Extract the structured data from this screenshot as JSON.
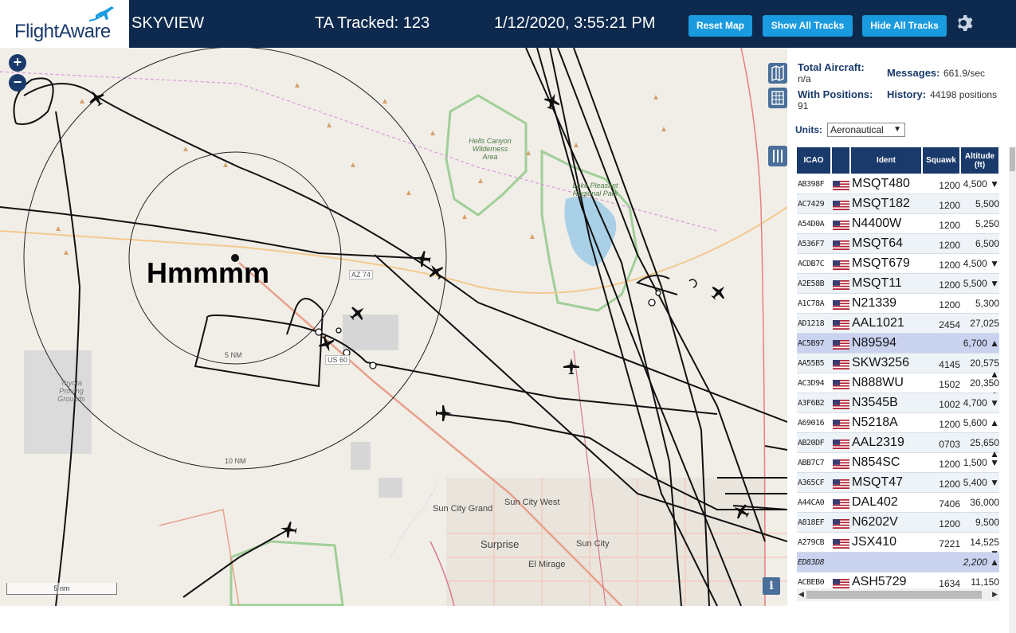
{
  "header": {
    "logo_text": "FlightAware",
    "title": "SKYVIEW",
    "tracked": "TA Tracked: 123",
    "datetime": "1/12/2020, 3:55:21 PM",
    "buttons": {
      "reset": "Reset Map",
      "show_all": "Show All Tracks",
      "hide_all": "Hide All Tracks"
    },
    "accent_color": "#1a9be0",
    "bar_color": "#0d2a4e"
  },
  "map": {
    "annotation": "Hmmmm",
    "scale_label": "5 nm",
    "zoom_in": "+",
    "zoom_out": "−",
    "info": "i",
    "range_rings": [
      "5 NM",
      "10 NM"
    ],
    "road_labels": [
      "AZ 74",
      "US 60"
    ],
    "places": {
      "hells_canyon": "Hells Canyon Wilderness Area",
      "lake_pleasant": "Lake Pleasant Regional Park",
      "toyota": "Toyota Proving Grounds",
      "sun_city_grand": "Sun City Grand",
      "sun_city_west": "Sun City West",
      "surprise": "Surprise",
      "sun_city": "Sun City",
      "el_mirage": "El Mirage"
    }
  },
  "stats": {
    "total_label": "Total Aircraft:",
    "total_value": "n/a",
    "positions_label": "With Positions:",
    "positions_value": "91",
    "messages_label": "Messages:",
    "messages_value": "661.9/sec",
    "history_label": "History:",
    "history_value": "44198 positions",
    "units_label": "Units:",
    "units_value": "Aeronautical"
  },
  "table": {
    "headers": {
      "icao": "ICAO",
      "ident": "Ident",
      "squawk": "Squawk",
      "altitude": "Altitude (ft)"
    },
    "rows": [
      {
        "icao": "AB398F",
        "ident": "MSQT480",
        "squawk": "1200",
        "alt": "4,500 ▼"
      },
      {
        "icao": "AC7429",
        "ident": "MSQT182",
        "squawk": "1200",
        "alt": "5,500"
      },
      {
        "icao": "A54D0A",
        "ident": "N4400W",
        "squawk": "1200",
        "alt": "5,250"
      },
      {
        "icao": "A536F7",
        "ident": "MSQT64",
        "squawk": "1200",
        "alt": "6,500"
      },
      {
        "icao": "ACDB7C",
        "ident": "MSQT679",
        "squawk": "1200",
        "alt": "4,500 ▼"
      },
      {
        "icao": "A2E58B",
        "ident": "MSQT11",
        "squawk": "1200",
        "alt": "5,500 ▼"
      },
      {
        "icao": "A1C78A",
        "ident": "N21339",
        "squawk": "1200",
        "alt": "5,300"
      },
      {
        "icao": "AD1218",
        "ident": "AAL1021",
        "squawk": "2454",
        "alt": "27,025"
      },
      {
        "icao": "AC5B97",
        "ident": "N89594",
        "squawk": "",
        "alt": "6,700 ▲"
      },
      {
        "icao": "AA55B5",
        "ident": "SKW3256",
        "squawk": "4145",
        "alt": "20,575 ▲"
      },
      {
        "icao": "AC3D94",
        "ident": "N888WU",
        "squawk": "1502",
        "alt": "20,350 ▲"
      },
      {
        "icao": "A3F6B2",
        "ident": "N3545B",
        "squawk": "1002",
        "alt": "4,700 ▼"
      },
      {
        "icao": "A69016",
        "ident": "N5218A",
        "squawk": "1200",
        "alt": "5,600 ▲"
      },
      {
        "icao": "AB20DF",
        "ident": "AAL2319",
        "squawk": "0703",
        "alt": "25,650 ▲"
      },
      {
        "icao": "ABB7C7",
        "ident": "N854SC",
        "squawk": "1200",
        "alt": "1,500 ▼"
      },
      {
        "icao": "A365CF",
        "ident": "MSQT47",
        "squawk": "1200",
        "alt": "5,400 ▼"
      },
      {
        "icao": "A44CA0",
        "ident": "DAL402",
        "squawk": "7406",
        "alt": "36,000"
      },
      {
        "icao": "A818EF",
        "ident": "N6202V",
        "squawk": "1200",
        "alt": "9,500"
      },
      {
        "icao": "A279CB",
        "ident": "JSX410",
        "squawk": "7221",
        "alt": "14,525 ▼"
      },
      {
        "icao": "ED83D8",
        "ident": "",
        "squawk": "",
        "alt": "2,200 ▲"
      },
      {
        "icao": "ACBEB0",
        "ident": "ASH5729",
        "squawk": "1634",
        "alt": "11,150 ▲"
      }
    ]
  }
}
